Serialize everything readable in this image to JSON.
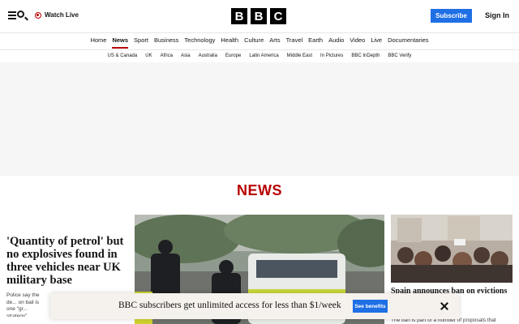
{
  "header": {
    "menu_icon": "menu-search-icon",
    "watch_live": "Watch Live",
    "logo_letters": [
      "B",
      "B",
      "C"
    ],
    "subscribe": "Subscribe",
    "sign_in": "Sign In"
  },
  "nav": {
    "items": [
      "Home",
      "News",
      "Sport",
      "Business",
      "Technology",
      "Health",
      "Culture",
      "Arts",
      "Travel",
      "Earth",
      "Audio",
      "Video",
      "Live",
      "Documentaries"
    ],
    "active": "News"
  },
  "subnav": {
    "items": [
      "US & Canada",
      "UK",
      "Africa",
      "Asia",
      "Australia",
      "Europe",
      "Latin America",
      "Middle East",
      "In Pictures",
      "BBC InDepth",
      "BBC Verify"
    ]
  },
  "section": {
    "title": "NEWS"
  },
  "lead_story": {
    "headline": "'Quantity of petrol' but no explosives found in three vehicles near UK military base",
    "summary": "Police say the de... on bail is one \"gr... strategy\"."
  },
  "right_story": {
    "headline": "Spain announces ban on evictions ... year-old ... a flat",
    "summary": "The ban is part of a number of proposals that"
  },
  "banner": {
    "text": "BBC subscribers get unlimited access for less than $1/week",
    "button": "See benefits",
    "close_icon": "close-icon"
  },
  "colors": {
    "brand_red": "#b80000",
    "accent_blue": "#1f6fe5",
    "banner_bg": "#f5f1ec"
  }
}
